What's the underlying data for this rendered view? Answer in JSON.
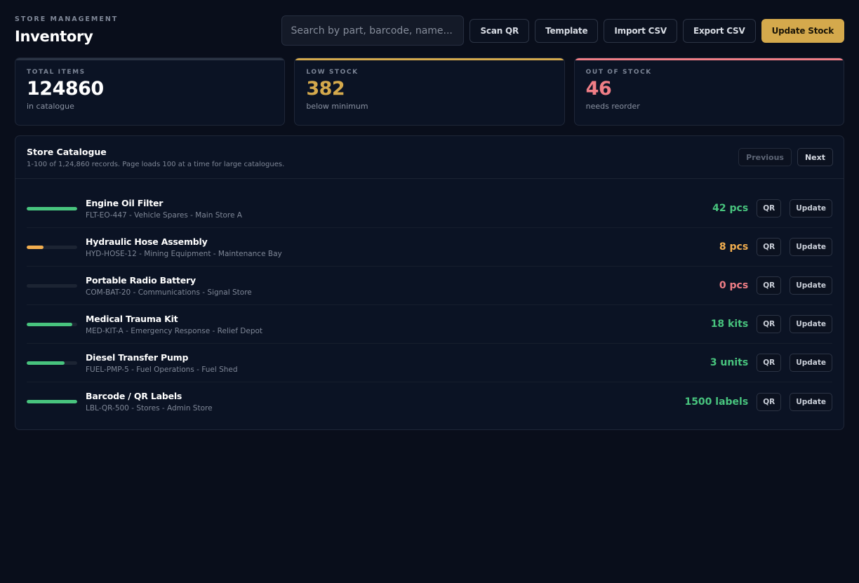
{
  "header": {
    "eyebrow": "STORE MANAGEMENT",
    "title": "Inventory",
    "search_placeholder": "Search by part, barcode, name...",
    "buttons": {
      "scan_qr": "Scan QR",
      "template": "Template",
      "import_csv": "Import CSV",
      "export_csv": "Export CSV",
      "update_stock": "Update Stock"
    }
  },
  "stats": [
    {
      "label": "TOTAL ITEMS",
      "value": "124860",
      "sub": "in catalogue",
      "accent": "#2b3444",
      "value_color": "#ffffff"
    },
    {
      "label": "LOW STOCK",
      "value": "382",
      "sub": "below minimum",
      "accent": "#d4a94c",
      "value_color": "#d4a94c"
    },
    {
      "label": "OUT OF STOCK",
      "value": "46",
      "sub": "needs reorder",
      "accent": "#f07e86",
      "value_color": "#f07e86"
    }
  ],
  "catalogue": {
    "title": "Store Catalogue",
    "subtitle": "1-100 of 1,24,860 records. Page loads 100 at a time for large catalogues.",
    "previous": "Previous",
    "next": "Next",
    "qr_label": "QR",
    "update_label": "Update",
    "items": [
      {
        "name": "Engine Oil Filter",
        "meta": "FLT-EO-447 - Vehicle Spares - Main Store A",
        "qty": "42 pcs",
        "level": 1.0,
        "bar_color": "#48c47e",
        "qty_color": "#48c47e"
      },
      {
        "name": "Hydraulic Hose Assembly",
        "meta": "HYD-HOSE-12 - Mining Equipment - Maintenance Bay",
        "qty": "8 pcs",
        "level": 0.33,
        "bar_color": "#f2ae4f",
        "qty_color": "#f2ae4f"
      },
      {
        "name": "Portable Radio Battery",
        "meta": "COM-BAT-20 - Communications - Signal Store",
        "qty": "0 pcs",
        "level": 0.0,
        "bar_color": "#f07e86",
        "qty_color": "#f07e86"
      },
      {
        "name": "Medical Trauma Kit",
        "meta": "MED-KIT-A - Emergency Response - Relief Depot",
        "qty": "18 kits",
        "level": 0.9,
        "bar_color": "#48c47e",
        "qty_color": "#48c47e"
      },
      {
        "name": "Diesel Transfer Pump",
        "meta": "FUEL-PMP-5 - Fuel Operations - Fuel Shed",
        "qty": "3 units",
        "level": 0.75,
        "bar_color": "#48c47e",
        "qty_color": "#48c47e"
      },
      {
        "name": "Barcode / QR Labels",
        "meta": "LBL-QR-500 - Stores - Admin Store",
        "qty": "1500 labels",
        "level": 1.0,
        "bar_color": "#48c47e",
        "qty_color": "#48c47e"
      }
    ]
  }
}
